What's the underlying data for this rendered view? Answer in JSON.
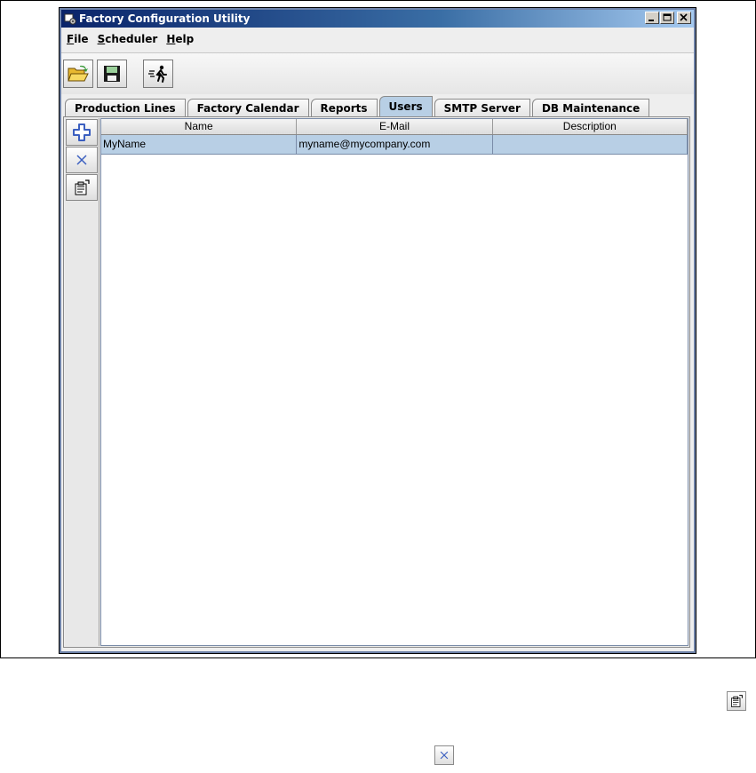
{
  "window": {
    "title": "Factory Configuration Utility"
  },
  "menu": {
    "items": [
      {
        "label": "File",
        "mnemonic": "F",
        "rest": "ile"
      },
      {
        "label": "Scheduler",
        "mnemonic": "S",
        "rest": "cheduler"
      },
      {
        "label": "Help",
        "mnemonic": "H",
        "rest": "elp"
      }
    ]
  },
  "toolbar": {
    "buttons": [
      "open-folder-icon",
      "save-disk-icon",
      "run-icon"
    ]
  },
  "tabs": [
    {
      "label": "Production Lines",
      "active": false
    },
    {
      "label": "Factory Calendar",
      "active": false
    },
    {
      "label": "Reports",
      "active": false
    },
    {
      "label": "Users",
      "active": true
    },
    {
      "label": "SMTP Server",
      "active": false
    },
    {
      "label": "DB Maintenance",
      "active": false
    }
  ],
  "side_toolbar": {
    "buttons": [
      "add-plus-icon",
      "delete-x-icon",
      "properties-icon"
    ]
  },
  "table": {
    "columns": [
      "Name",
      "E-Mail",
      "Description"
    ],
    "rows": [
      {
        "name": "MyName",
        "email": "myname@mycompany.com",
        "description": "",
        "selected": true
      }
    ]
  },
  "colors": {
    "selection": "#b8cfe5",
    "titlebar_start": "#0a246a",
    "plus_blue": "#3b5fc0"
  }
}
